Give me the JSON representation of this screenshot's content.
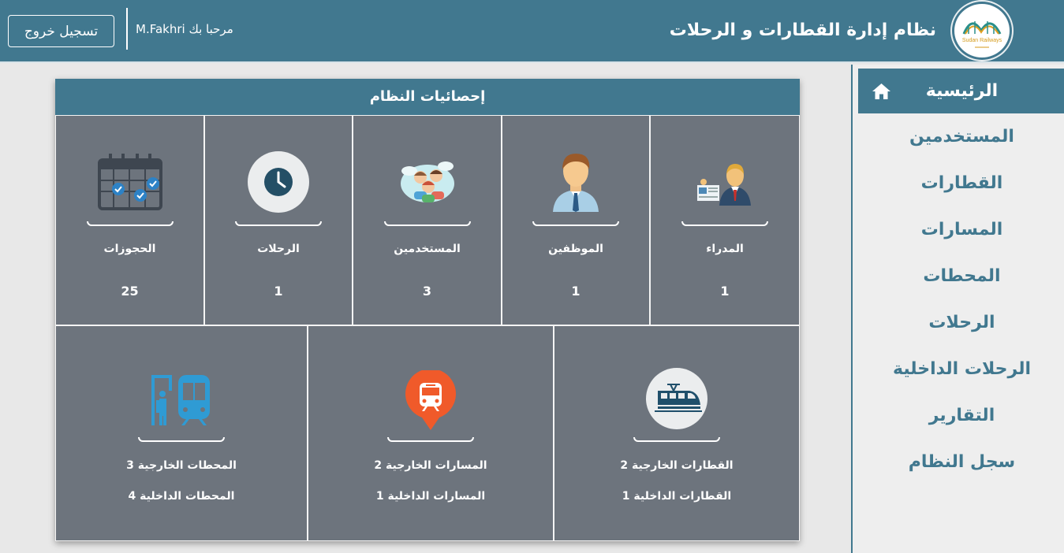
{
  "header": {
    "app_title": "نظام إدارة القطارات و الرحلات",
    "welcome_prefix": "مرحبا بك",
    "username": "M.Fakhri",
    "logout_label": "تسجيل خروج",
    "logo_text": "Sudan Railways",
    "logo_icon": "sudan-railways-logo"
  },
  "sidebar": {
    "items": [
      {
        "label": "الرئيسية",
        "icon": "home-icon",
        "active": true
      },
      {
        "label": "المستخدمين"
      },
      {
        "label": "القطارات"
      },
      {
        "label": "المسارات"
      },
      {
        "label": "المحطات"
      },
      {
        "label": "الرحلات"
      },
      {
        "label": "الرحلات الداخلية"
      },
      {
        "label": "التقارير"
      },
      {
        "label": "سجل النظام"
      }
    ]
  },
  "stats": {
    "title": "إحصائيات النظام",
    "top": [
      {
        "label": "المدراء",
        "value": "1",
        "icon": "manager-icon"
      },
      {
        "label": "الموظفين",
        "value": "1",
        "icon": "employee-icon"
      },
      {
        "label": "المستخدمين",
        "value": "3",
        "icon": "users-icon"
      },
      {
        "label": "الرحلات",
        "value": "1",
        "icon": "clock-icon"
      },
      {
        "label": "الحجوزات",
        "value": "25",
        "icon": "calendar-icon"
      }
    ],
    "bottom": [
      {
        "line1": "القطارات الخارجية 2",
        "line2": "القطارات الداخلية 1",
        "icon": "train-icon"
      },
      {
        "line1": "المسارات الخارجية 2",
        "line2": "المسارات الداخلية 1",
        "icon": "route-pin-icon"
      },
      {
        "line1": "المحطات الخارجية 3",
        "line2": "المحطات الداخلية 4",
        "icon": "station-icon"
      }
    ]
  },
  "colors": {
    "primary": "#41788f",
    "panel": "#6d747d",
    "background": "#e8e8e8"
  }
}
